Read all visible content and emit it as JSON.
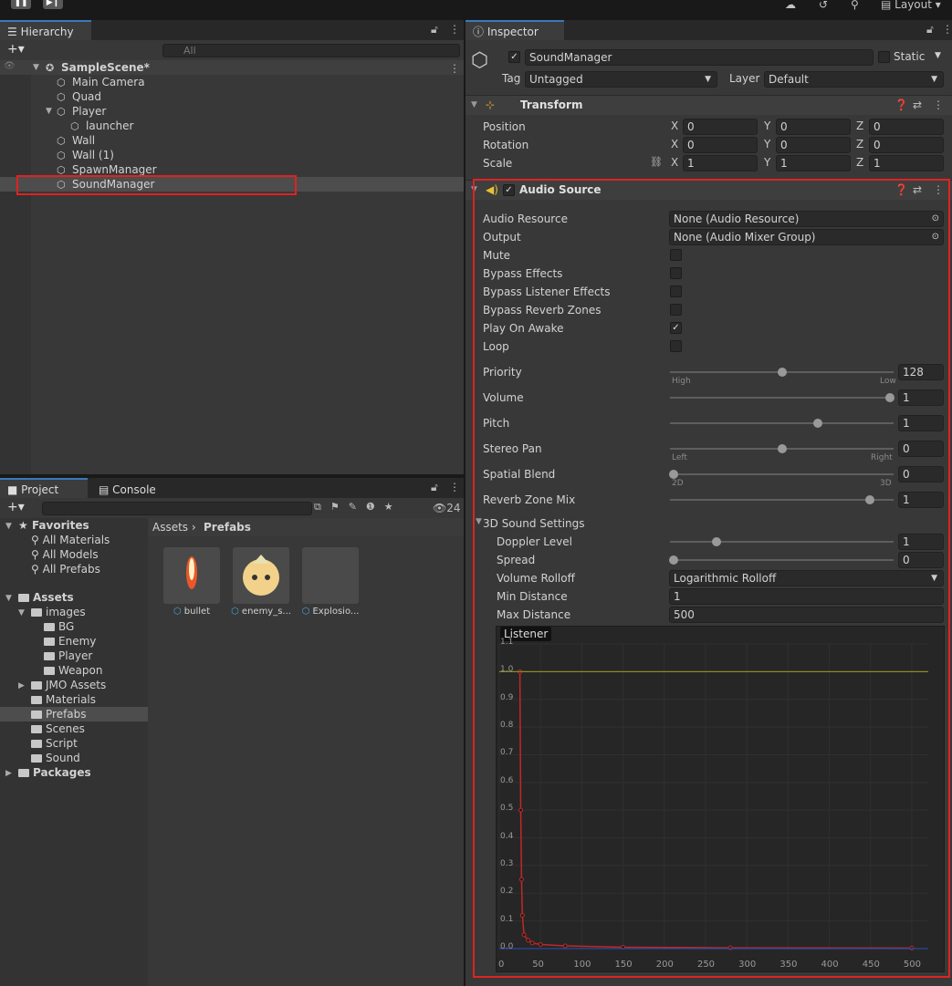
{
  "toolbar": {
    "layout_label": "Layout"
  },
  "hierarchy": {
    "tab_label": "Hierarchy",
    "search_placeholder": "All",
    "scene_name": "SampleScene*",
    "items": [
      {
        "label": "Main Camera"
      },
      {
        "label": "Quad"
      },
      {
        "label": "Player"
      },
      {
        "label": "launcher"
      },
      {
        "label": "Wall"
      },
      {
        "label": "Wall (1)"
      },
      {
        "label": "SpawnManager"
      },
      {
        "label": "SoundManager"
      }
    ],
    "selected": "SoundManager"
  },
  "project": {
    "tabs": [
      {
        "label": "Project"
      },
      {
        "label": "Console"
      }
    ],
    "hidden_count": "24",
    "favorites_label": "Favorites",
    "favorites": [
      "All Materials",
      "All Models",
      "All Prefabs"
    ],
    "assets_label": "Assets",
    "tree": [
      "images",
      "BG",
      "Enemy",
      "Player",
      "Weapon",
      "JMO Assets",
      "Materials",
      "Prefabs",
      "Scenes",
      "Script",
      "Sound"
    ],
    "packages_label": "Packages",
    "breadcrumb": [
      "Assets",
      "Prefabs"
    ],
    "assets": [
      "bullet",
      "enemy_s...",
      "Explosio..."
    ]
  },
  "inspector": {
    "tab_label": "Inspector",
    "object_name": "SoundManager",
    "static_label": "Static",
    "tag_label": "Tag",
    "tag_value": "Untagged",
    "layer_label": "Layer",
    "layer_value": "Default",
    "transform": {
      "title": "Transform",
      "rows": [
        {
          "label": "Position",
          "x": "0",
          "y": "0",
          "z": "0"
        },
        {
          "label": "Rotation",
          "x": "0",
          "y": "0",
          "z": "0"
        },
        {
          "label": "Scale",
          "x": "1",
          "y": "1",
          "z": "1"
        }
      ]
    },
    "audio_source": {
      "title": "Audio Source",
      "audio_resource_label": "Audio Resource",
      "audio_resource_value": "None (Audio Resource)",
      "output_label": "Output",
      "output_value": "None (Audio Mixer Group)",
      "toggles": [
        {
          "label": "Mute",
          "checked": false
        },
        {
          "label": "Bypass Effects",
          "checked": false
        },
        {
          "label": "Bypass Listener Effects",
          "checked": false
        },
        {
          "label": "Bypass Reverb Zones",
          "checked": false
        },
        {
          "label": "Play On Awake",
          "checked": true
        },
        {
          "label": "Loop",
          "checked": false
        }
      ],
      "sliders": [
        {
          "label": "Priority",
          "value": "128",
          "fraction": 0.5,
          "left": "High",
          "right": "Low"
        },
        {
          "label": "Volume",
          "value": "1",
          "fraction": 1.0
        },
        {
          "label": "Pitch",
          "value": "1",
          "fraction": 0.667
        },
        {
          "label": "Stereo Pan",
          "value": "0",
          "fraction": 0.5,
          "left": "Left",
          "right": "Right"
        },
        {
          "label": "Spatial Blend",
          "value": "0",
          "fraction": 0.0,
          "left": "2D",
          "right": "3D"
        },
        {
          "label": "Reverb Zone Mix",
          "value": "1",
          "fraction": 0.909
        }
      ],
      "sound3d_label": "3D Sound Settings",
      "doppler_label": "Doppler Level",
      "doppler_value": "1",
      "doppler_fraction": 0.2,
      "spread_label": "Spread",
      "spread_value": "0",
      "spread_fraction": 0.0,
      "rolloff_label": "Volume Rolloff",
      "rolloff_value": "Logarithmic Rolloff",
      "min_distance_label": "Min Distance",
      "min_distance_value": "1",
      "max_distance_label": "Max Distance",
      "max_distance_value": "500",
      "listener_label": "Listener"
    }
  },
  "chart_data": {
    "type": "line",
    "title": "",
    "xlabel": "",
    "ylabel": "",
    "xlim": [
      0,
      520
    ],
    "ylim": [
      0,
      1.1
    ],
    "x_ticks": [
      0,
      50,
      100,
      150,
      200,
      250,
      300,
      350,
      400,
      450,
      500
    ],
    "y_ticks": [
      0.0,
      0.1,
      0.2,
      0.3,
      0.4,
      0.5,
      0.6,
      0.7,
      0.8,
      0.9,
      1.0,
      1.1
    ],
    "legend": "none",
    "grid": true,
    "series": [
      {
        "color": "#c02828",
        "x": [
          25,
          26,
          27,
          28,
          30,
          35,
          40,
          50,
          80,
          150,
          280,
          500
        ],
        "y": [
          1.0,
          0.5,
          0.25,
          0.12,
          0.05,
          0.03,
          0.02,
          0.015,
          0.01,
          0.005,
          0.003,
          0.002
        ]
      },
      {
        "color": "#8a8a2a",
        "x": [
          0,
          520
        ],
        "y": [
          1.0,
          1.0
        ]
      },
      {
        "color": "#2a4aa0",
        "x": [
          0,
          520
        ],
        "y": [
          0.0,
          0.0
        ]
      }
    ],
    "colors": {
      "accent": "#3a79bb",
      "highlight": "#e02222"
    }
  }
}
